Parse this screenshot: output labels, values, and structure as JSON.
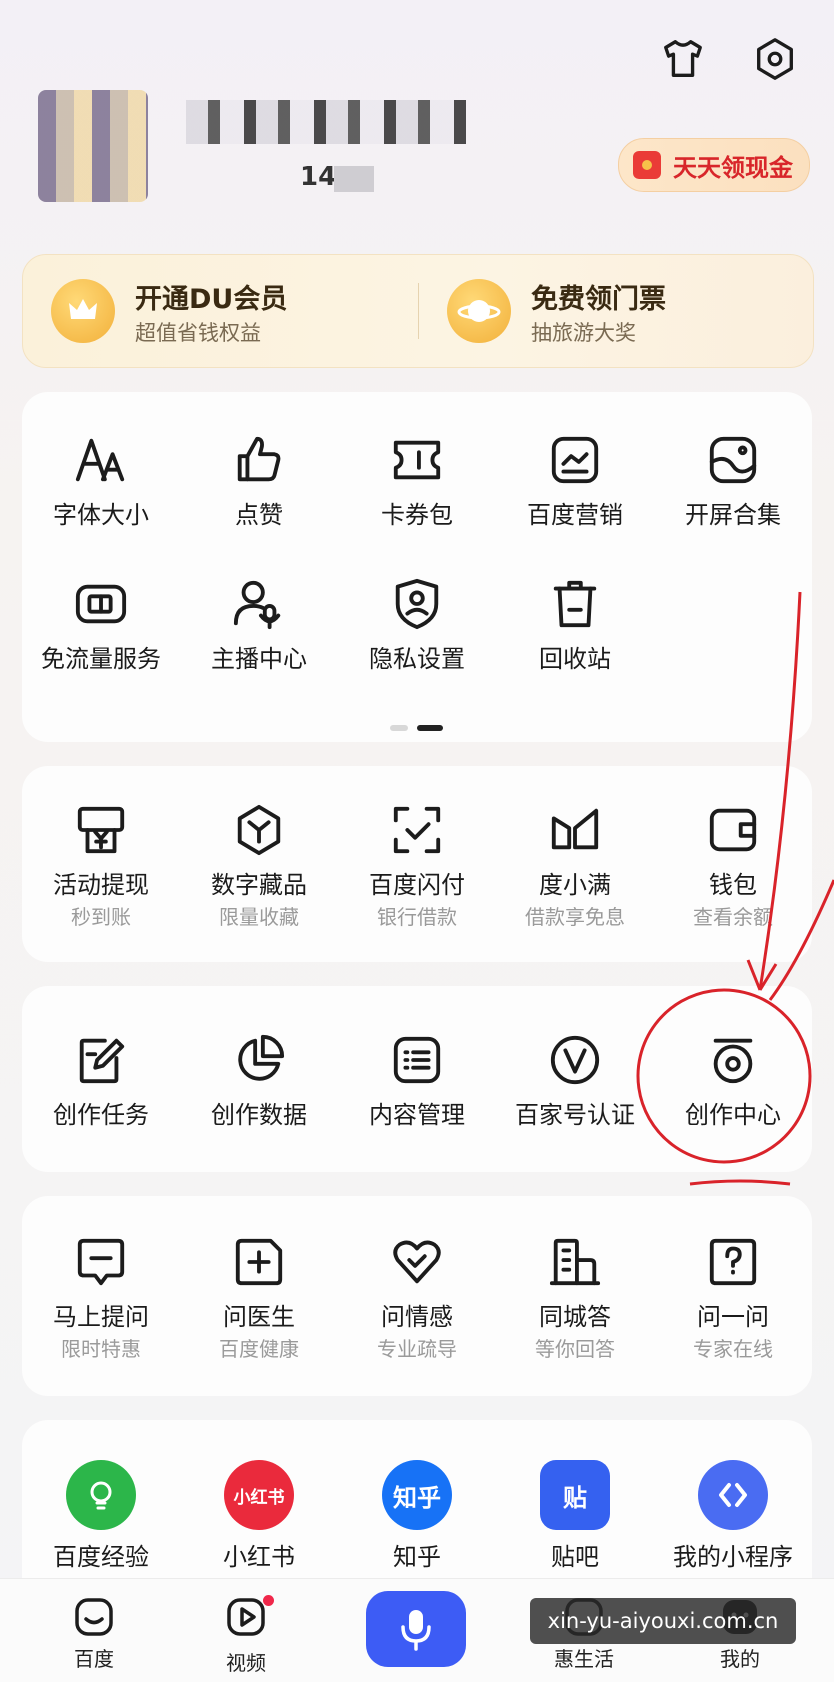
{
  "header": {
    "user_id_partial": "14",
    "red_packet_label": "天天领现金",
    "icons": [
      "tshirt-icon",
      "gear-icon"
    ]
  },
  "vip": {
    "left_title": "开通DU会员",
    "left_sub": "超值省钱权益",
    "right_title": "免费领门票",
    "right_sub": "抽旅游大奖"
  },
  "tools": {
    "row1": [
      "字体大小",
      "点赞",
      "卡券包",
      "百度营销",
      "开屏合集"
    ],
    "row2": [
      "免流量服务",
      "主播中心",
      "隐私设置",
      "回收站"
    ]
  },
  "finance": [
    {
      "label": "活动提现",
      "sub": "秒到账"
    },
    {
      "label": "数字藏品",
      "sub": "限量收藏"
    },
    {
      "label": "百度闪付",
      "sub": "银行借款"
    },
    {
      "label": "度小满",
      "sub": "借款享免息"
    },
    {
      "label": "钱包",
      "sub": "查看余额"
    }
  ],
  "creator": [
    "创作任务",
    "创作数据",
    "内容管理",
    "百家号认证",
    "创作中心"
  ],
  "ask": [
    {
      "label": "马上提问",
      "sub": "限时特惠"
    },
    {
      "label": "问医生",
      "sub": "百度健康"
    },
    {
      "label": "问情感",
      "sub": "专业疏导"
    },
    {
      "label": "同城答",
      "sub": "等你回答"
    },
    {
      "label": "问一问",
      "sub": "专家在线"
    }
  ],
  "apps": [
    {
      "label": "百度经验",
      "glyph": "",
      "color": "#2cb64a"
    },
    {
      "label": "小红书",
      "glyph": "小红书",
      "color": "#ea2a3c"
    },
    {
      "label": "知乎",
      "glyph": "知乎",
      "color": "#1772f6"
    },
    {
      "label": "贴吧",
      "glyph": "贴",
      "color": "#3561f0"
    },
    {
      "label": "我的小程序",
      "glyph": "",
      "color": "#4a6cf2"
    }
  ],
  "tabbar": {
    "baidu": "百度",
    "video": "视频",
    "life": "惠生活",
    "mine": "我的"
  },
  "watermark": "xin-yu-aiyouxi.com.cn",
  "colors": {
    "annotation_red": "#d9232a",
    "voice_button": "#3d5cf5"
  }
}
